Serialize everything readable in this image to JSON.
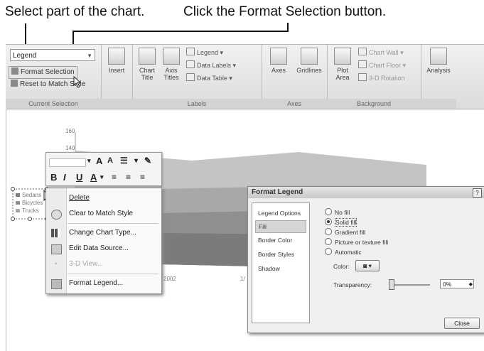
{
  "callouts": {
    "left": "Select part of the chart.",
    "right": "Click the Format Selection button."
  },
  "ribbon": {
    "selector_value": "Legend",
    "format_selection": "Format Selection",
    "reset_match": "Reset to Match Style",
    "current_selection_title": "Current Selection",
    "insert": "Insert",
    "chart_title": "Chart Title",
    "axis_titles": "Axis Titles",
    "legend": "Legend",
    "data_labels": "Data Labels",
    "data_table": "Data Table",
    "labels_title": "Labels",
    "axes": "Axes",
    "gridlines": "Gridlines",
    "axes_title": "Axes",
    "plot_area": "Plot Area",
    "chart_wall": "Chart Wall",
    "chart_floor": "Chart Floor",
    "rotation": "3-D Rotation",
    "background_title": "Background",
    "analysis": "Analysis"
  },
  "chart": {
    "ytick_160": "160",
    "ytick_140": "140",
    "legend_items": [
      "Sedans",
      "Bicycles",
      "Trucks"
    ],
    "xtick_1": "2002",
    "xtick_2": "1/"
  },
  "mini_toolbar": {
    "grow": "A",
    "shrink": "A",
    "bold": "B",
    "italic": "I",
    "underline": "U",
    "font_color": "A"
  },
  "context_menu": [
    {
      "label": "Delete",
      "enabled": true
    },
    {
      "label": "Clear to Match Style",
      "enabled": true
    },
    {
      "label": "Change Chart Type...",
      "enabled": true
    },
    {
      "label": "Edit Data Source...",
      "enabled": true
    },
    {
      "label": "3-D View...",
      "enabled": false
    },
    {
      "label": "Format Legend...",
      "enabled": true
    }
  ],
  "dialog": {
    "title": "Format Legend",
    "help": "?",
    "nav": [
      "Legend Options",
      "Fill",
      "Border Color",
      "Border Styles",
      "Shadow"
    ],
    "fill_options": [
      "No fill",
      "Solid fill",
      "Gradient fill",
      "Picture or texture fill",
      "Automatic"
    ],
    "color_label": "Color:",
    "transparency_label": "Transparency:",
    "transparency_value": "0%",
    "close": "Close"
  },
  "colors": {
    "chart_dark": "#7b7b7b",
    "chart_mid": "#8f8f8f",
    "chart_light": "#a8a8a8",
    "chart_lighter": "#c4c4c4"
  }
}
